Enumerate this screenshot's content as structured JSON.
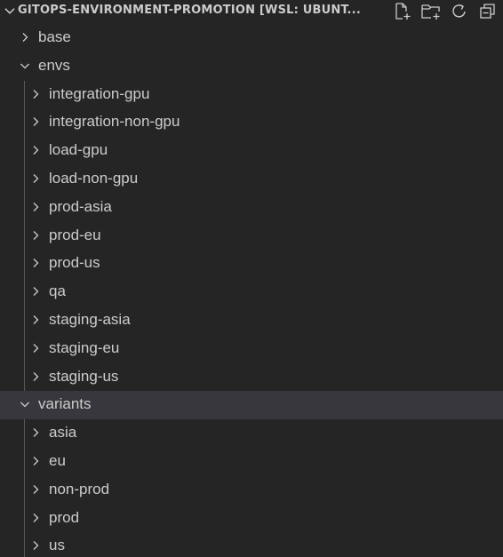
{
  "header": {
    "title": "GITOPS-ENVIRONMENT-PROMOTION [WSL: UBUNT...",
    "actions": [
      {
        "name": "new-file-icon"
      },
      {
        "name": "new-folder-icon"
      },
      {
        "name": "refresh-icon"
      },
      {
        "name": "collapse-all-icon"
      }
    ]
  },
  "tree": {
    "base": {
      "label": "base",
      "expanded": false
    },
    "envs": {
      "label": "envs",
      "expanded": true,
      "children": [
        "integration-gpu",
        "integration-non-gpu",
        "load-gpu",
        "load-non-gpu",
        "prod-asia",
        "prod-eu",
        "prod-us",
        "qa",
        "staging-asia",
        "staging-eu",
        "staging-us"
      ]
    },
    "variants": {
      "label": "variants",
      "expanded": true,
      "selected": true,
      "children": [
        "asia",
        "eu",
        "non-prod",
        "prod",
        "us"
      ]
    }
  },
  "colors": {
    "background": "#252526",
    "text": "#cccccc",
    "selected_row": "#37373d",
    "indent_guide": "#585858"
  }
}
